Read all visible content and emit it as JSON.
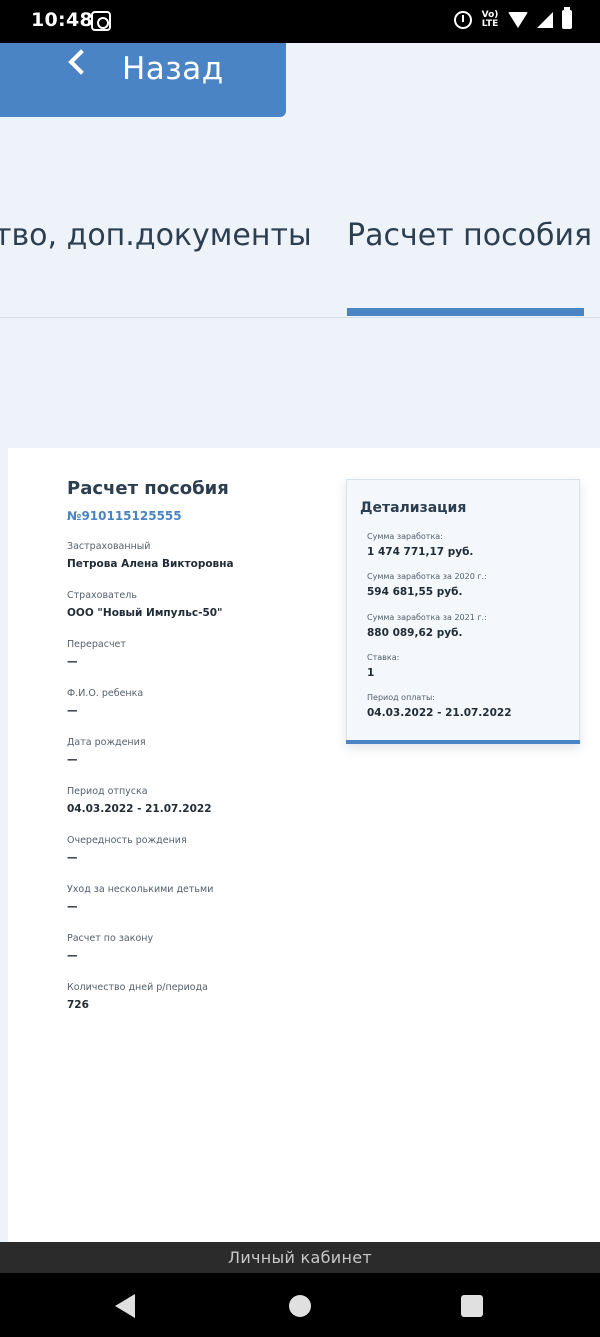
{
  "status_bar": {
    "time": "10:48",
    "volte": "Vo) LTE"
  },
  "header": {
    "back_label": "Назад"
  },
  "tabs": [
    {
      "label": "тво, доп.документы",
      "active": false
    },
    {
      "label": "Расчет пособия",
      "active": true
    }
  ],
  "document": {
    "title": "Расчет пособия",
    "number": "№910115125555",
    "fields": [
      {
        "label": "Застрахованный",
        "value": "Петрова Алена Викторовна"
      },
      {
        "label": "Страхователь",
        "value": "ООО \"Новый Импульс-50\""
      },
      {
        "label": "Перерасчет",
        "value": "—"
      },
      {
        "label": "Ф.И.О. ребенка",
        "value": "—"
      },
      {
        "label": "Дата рождения",
        "value": "—"
      },
      {
        "label": "Период отпуска",
        "value": "04.03.2022 - 21.07.2022"
      },
      {
        "label": "Очередность рождения",
        "value": "—"
      },
      {
        "label": "Уход за несколькими детьми",
        "value": "—"
      },
      {
        "label": "Расчет по закону",
        "value": "—"
      },
      {
        "label": "Количество дней р/периода",
        "value": "726"
      }
    ]
  },
  "details": {
    "title": "Детализация",
    "fields": [
      {
        "label": "Сумма заработка:",
        "value": "1 474 771,17 руб."
      },
      {
        "label": "Сумма заработка за 2020 г.:",
        "value": "594 681,55 руб."
      },
      {
        "label": "Сумма заработка за 2021 г.:",
        "value": "880 089,62 руб."
      },
      {
        "label": "Ставка:",
        "value": "1"
      },
      {
        "label": "Период оплаты:",
        "value": "04.03.2022 - 21.07.2022"
      }
    ]
  },
  "footer": {
    "title": "Личный кабинет"
  },
  "colors": {
    "accent": "#4a84c4",
    "background": "#eef3fa",
    "text": "#2c3e50"
  }
}
